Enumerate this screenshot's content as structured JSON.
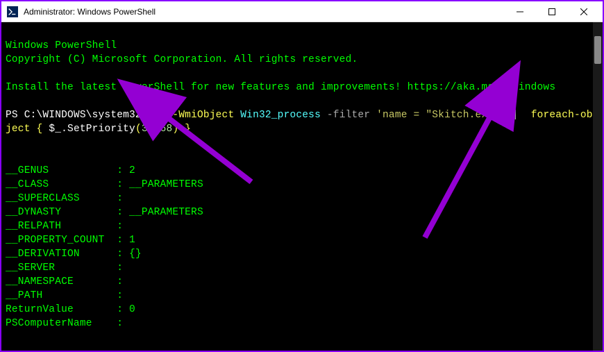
{
  "window": {
    "title": "Administrator: Windows PowerShell"
  },
  "terminal": {
    "header1": "Windows PowerShell",
    "header2": "Copyright (C) Microsoft Corporation. All rights reserved.",
    "install_msg": "Install the latest PowerShell for new features and improvements! https://aka.ms/PSWindows",
    "prompt": "PS C:\\WINDOWS\\system32>",
    "cmd": {
      "get_wmi": "Get-WmiObject",
      "class": "Win32_process",
      "filter_flag": "-filter",
      "filter_open": "'name = \"",
      "filter_target": "Skitch.exe",
      "filter_close": "\"'",
      "pipe": " | ",
      "foreach": "foreach-object",
      "brace_open": " { ",
      "dollar_under": "$_",
      "method_dot": ".SetPriority",
      "paren_open": "(",
      "priority_value": "32768",
      "paren_close": ")",
      "brace_close": " }"
    },
    "output": [
      {
        "key": "__GENUS",
        "sep": " : ",
        "val": "2"
      },
      {
        "key": "__CLASS",
        "sep": " : ",
        "val": "__PARAMETERS"
      },
      {
        "key": "__SUPERCLASS",
        "sep": " : ",
        "val": ""
      },
      {
        "key": "__DYNASTY",
        "sep": " : ",
        "val": "__PARAMETERS"
      },
      {
        "key": "__RELPATH",
        "sep": " : ",
        "val": ""
      },
      {
        "key": "__PROPERTY_COUNT",
        "sep": " : ",
        "val": "1"
      },
      {
        "key": "__DERIVATION",
        "sep": " : ",
        "val": "{}"
      },
      {
        "key": "__SERVER",
        "sep": " : ",
        "val": ""
      },
      {
        "key": "__NAMESPACE",
        "sep": " : ",
        "val": ""
      },
      {
        "key": "__PATH",
        "sep": " : ",
        "val": ""
      },
      {
        "key": "ReturnValue",
        "sep": " : ",
        "val": "0"
      },
      {
        "key": "PSComputerName",
        "sep": " : ",
        "val": ""
      }
    ]
  },
  "annotations": {
    "arrow_color": "#9400D3"
  }
}
